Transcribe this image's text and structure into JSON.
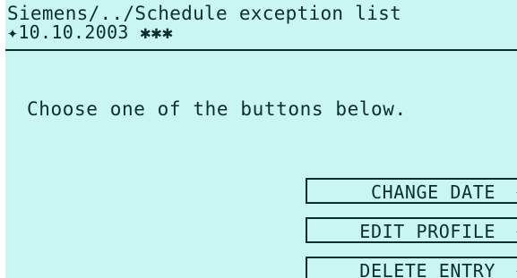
{
  "header": {
    "title": "Siemens/../Schedule exception list",
    "subtitle": "✦10.10.2003 ✱✱✱"
  },
  "main": {
    "message": "Choose one of the buttons below."
  },
  "buttons": [
    {
      "label": "CHANGE DATE",
      "arrow": "◀"
    },
    {
      "label": "EDIT PROFILE",
      "arrow": "◀"
    },
    {
      "label": "DELETE ENTRY",
      "arrow": "◀"
    }
  ],
  "colors": {
    "screen_background": "#c9f5f3",
    "text": "#0a2e30"
  }
}
